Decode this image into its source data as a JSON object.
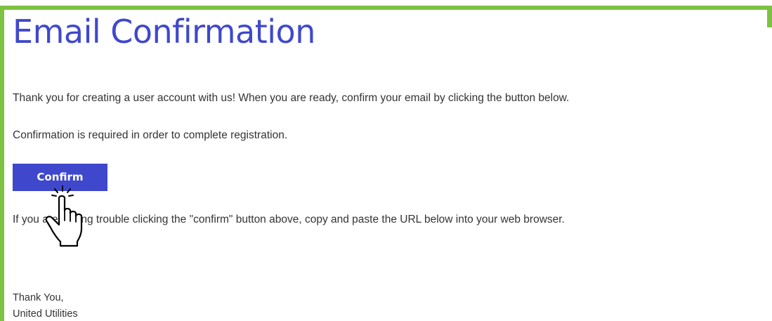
{
  "email": {
    "title": "Email Confirmation",
    "intro": "Thank you for creating a user account with us! When you are ready, confirm your email by clicking the button below.",
    "requirement": "Confirmation is required in order to complete registration.",
    "confirm_label": "Confirm",
    "trouble": "If you are having trouble clicking the \"confirm\" button above, copy and paste the URL below into your web browser.",
    "signoff": "Thank You,",
    "signature": "United Utilities"
  },
  "colors": {
    "border": "#7dc242",
    "title": "#3f48cc",
    "button": "#3f48cc",
    "text": "#333333"
  },
  "icons": {
    "cursor": "hand-pointer-icon"
  }
}
